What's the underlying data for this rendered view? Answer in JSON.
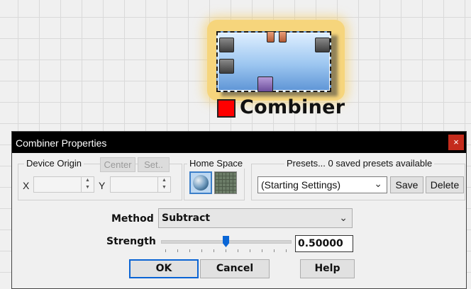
{
  "node": {
    "name": "Combiner",
    "status_color": "#ff0000",
    "body_color": "#9cc6f0",
    "highlight_color": "#f6d57c"
  },
  "dialog": {
    "title": "Combiner Properties",
    "close_icon": "×",
    "device_origin": {
      "label": "Device Origin",
      "center_label": "Center",
      "set_label": "Set..",
      "x_label": "X",
      "y_label": "Y",
      "x_value": "",
      "y_value": ""
    },
    "home_space": {
      "label": "Home Space",
      "icons": [
        "globe-icon",
        "grid-icon"
      ]
    },
    "presets": {
      "label": "Presets... 0 saved presets available",
      "selected": "(Starting Settings)",
      "save_label": "Save",
      "delete_label": "Delete"
    },
    "method": {
      "label": "Method",
      "selected": "Subtract"
    },
    "strength": {
      "label": "Strength",
      "value": "0.50000",
      "level": 0.5
    },
    "buttons": {
      "ok": "OK",
      "cancel": "Cancel",
      "help": "Help"
    }
  }
}
